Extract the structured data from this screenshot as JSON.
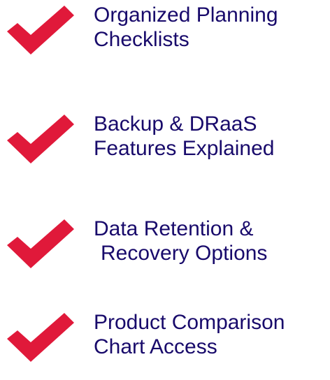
{
  "accent_color": "#e0193a",
  "text_color": "#180a6b",
  "features": [
    {
      "icon": "checkmark-icon",
      "line1": "Organized Planning",
      "line2": "Checklists"
    },
    {
      "icon": "checkmark-icon",
      "line1": "Backup & DRaaS",
      "line2": "Features Explained"
    },
    {
      "icon": "checkmark-icon",
      "line1": "Data Retention &",
      "line2": "Recovery Options"
    },
    {
      "icon": "checkmark-icon",
      "line1": "Product Comparison",
      "line2": "Chart Access"
    }
  ]
}
